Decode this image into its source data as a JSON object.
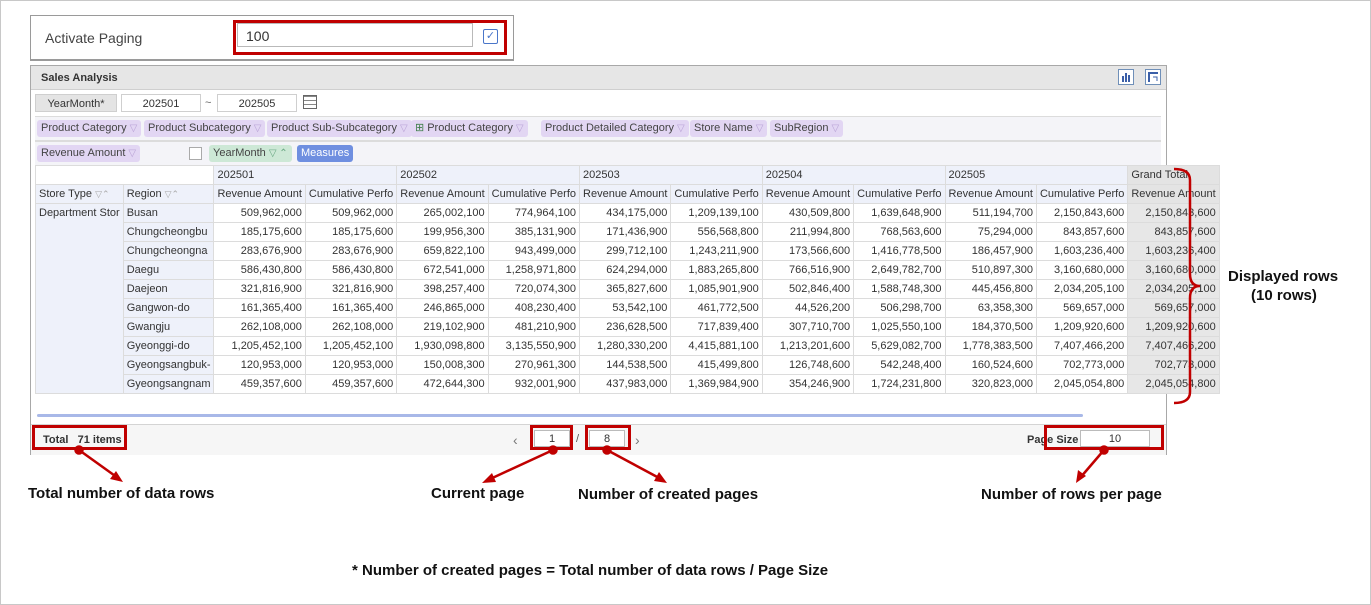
{
  "paging": {
    "label": "Activate Paging",
    "value": "100",
    "checked": "✓"
  },
  "widget": {
    "title": "Sales Analysis",
    "icons": [
      "bar-chart-icon",
      "pivot-icon"
    ],
    "filter": {
      "label": "YearMonth*",
      "from": "202501",
      "tilde": "~",
      "to": "202505"
    },
    "row_chips": [
      "Product Category",
      "Product Subcategory",
      "Product Sub-Subcategory",
      "Product Category",
      "Product Detailed Category",
      "Store Name",
      "SubRegion"
    ],
    "value_chip": "Revenue Amount",
    "col_chip": "YearMonth",
    "measures_chip": "Measures",
    "periods": [
      "202501",
      "202502",
      "202503",
      "202504",
      "202505"
    ],
    "grand_total": "Grand Total",
    "row_headers": [
      "Store Type",
      "Region"
    ],
    "measure_headers": [
      "Revenue Amount",
      "Cumulative Perfo"
    ],
    "store_type": "Department Stor",
    "rows": [
      {
        "region": "Busan",
        "values": [
          "509,962,000",
          "509,962,000",
          "265,002,100",
          "774,964,100",
          "434,175,000",
          "1,209,139,100",
          "430,509,800",
          "1,639,648,900",
          "511,194,700",
          "2,150,843,600"
        ],
        "total": "2,150,843,600"
      },
      {
        "region": "Chungcheongbu",
        "values": [
          "185,175,600",
          "185,175,600",
          "199,956,300",
          "385,131,900",
          "171,436,900",
          "556,568,800",
          "211,994,800",
          "768,563,600",
          "75,294,000",
          "843,857,600"
        ],
        "total": "843,857,600"
      },
      {
        "region": "Chungcheongna",
        "values": [
          "283,676,900",
          "283,676,900",
          "659,822,100",
          "943,499,000",
          "299,712,100",
          "1,243,211,900",
          "173,566,600",
          "1,416,778,500",
          "186,457,900",
          "1,603,236,400"
        ],
        "total": "1,603,236,400"
      },
      {
        "region": "Daegu",
        "values": [
          "586,430,800",
          "586,430,800",
          "672,541,000",
          "1,258,971,800",
          "624,294,000",
          "1,883,265,800",
          "766,516,900",
          "2,649,782,700",
          "510,897,300",
          "3,160,680,000"
        ],
        "total": "3,160,680,000"
      },
      {
        "region": "Daejeon",
        "values": [
          "321,816,900",
          "321,816,900",
          "398,257,400",
          "720,074,300",
          "365,827,600",
          "1,085,901,900",
          "502,846,400",
          "1,588,748,300",
          "445,456,800",
          "2,034,205,100"
        ],
        "total": "2,034,205,100"
      },
      {
        "region": "Gangwon-do",
        "values": [
          "161,365,400",
          "161,365,400",
          "246,865,000",
          "408,230,400",
          "53,542,100",
          "461,772,500",
          "44,526,200",
          "506,298,700",
          "63,358,300",
          "569,657,000"
        ],
        "total": "569,657,000"
      },
      {
        "region": "Gwangju",
        "values": [
          "262,108,000",
          "262,108,000",
          "219,102,900",
          "481,210,900",
          "236,628,500",
          "717,839,400",
          "307,710,700",
          "1,025,550,100",
          "184,370,500",
          "1,209,920,600"
        ],
        "total": "1,209,920,600"
      },
      {
        "region": "Gyeonggi-do",
        "values": [
          "1,205,452,100",
          "1,205,452,100",
          "1,930,098,800",
          "3,135,550,900",
          "1,280,330,200",
          "4,415,881,100",
          "1,213,201,600",
          "5,629,082,700",
          "1,778,383,500",
          "7,407,466,200"
        ],
        "total": "7,407,466,200"
      },
      {
        "region": "Gyeongsangbuk-",
        "values": [
          "120,953,000",
          "120,953,000",
          "150,008,300",
          "270,961,300",
          "144,538,500",
          "415,499,800",
          "126,748,600",
          "542,248,400",
          "160,524,600",
          "702,773,000"
        ],
        "total": "702,773,000"
      },
      {
        "region": "Gyeongsangnam",
        "values": [
          "459,357,600",
          "459,357,600",
          "472,644,300",
          "932,001,900",
          "437,983,000",
          "1,369,984,900",
          "354,246,900",
          "1,724,231,800",
          "320,823,000",
          "2,045,054,800"
        ],
        "total": "2,045,054,800"
      }
    ],
    "footer": {
      "total": "Total   71 items",
      "prev": "‹",
      "current_page": "1",
      "slash": "/",
      "page_count": "8",
      "next": "›",
      "page_size_label": "Page Size",
      "page_size": "10"
    }
  },
  "annotations": {
    "displayed_rows": "Displayed rows",
    "displayed_rows_count": "(10 rows)",
    "total_rows": "Total number of data rows",
    "current_page": "Current page",
    "created_pages": "Number of created pages",
    "rows_per_page": "Number of rows per page",
    "formula": "* Number of created pages = Total number of data rows / Page Size"
  },
  "colors": {
    "highlight": "#c00000",
    "accent": "#6f8fe0"
  }
}
